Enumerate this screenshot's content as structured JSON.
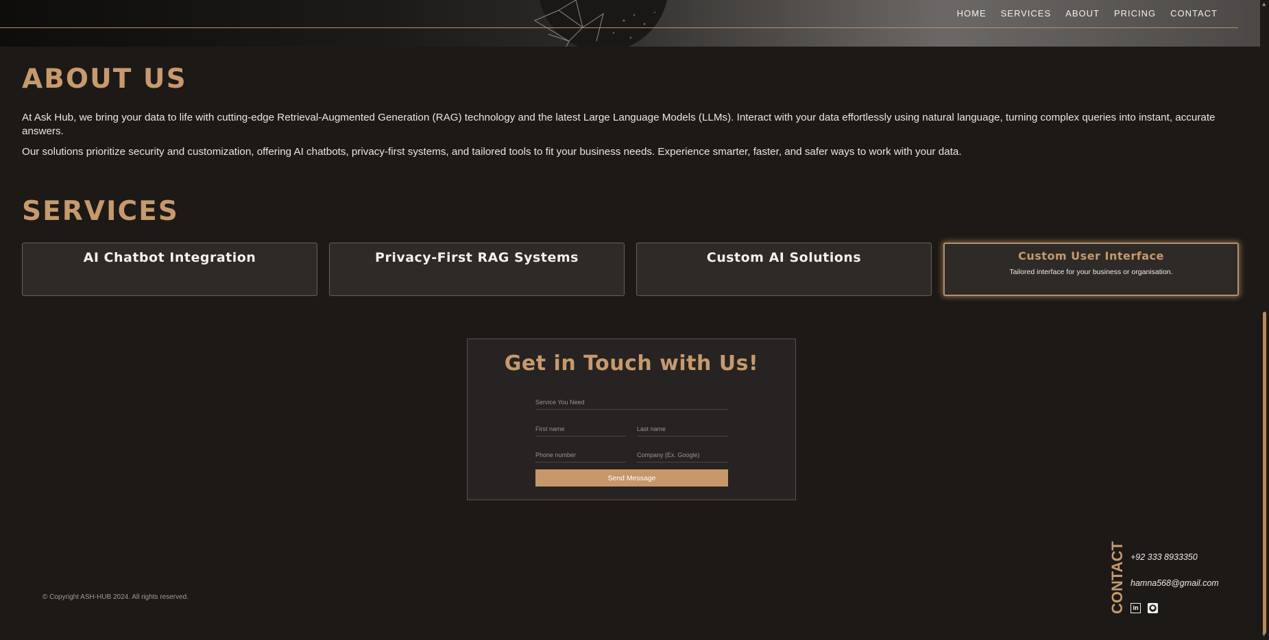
{
  "nav": {
    "items": [
      "HOME",
      "SERVICES",
      "ABOUT",
      "PRICING",
      "CONTACT"
    ]
  },
  "about": {
    "title": "ABOUT US",
    "p1": "At Ask Hub, we bring your data to life with cutting-edge Retrieval-Augmented Generation (RAG) technology and the latest Large Language Models (LLMs). Interact with your data effortlessly using natural language, turning complex queries into instant, accurate answers.",
    "p2": "Our solutions prioritize security and customization, offering AI chatbots, privacy-first systems, and tailored tools to fit your business needs. Experience smarter, faster, and safer ways to work with your data."
  },
  "services": {
    "title": "SERVICES",
    "cards": [
      {
        "title": "AI Chatbot Integration",
        "desc": ""
      },
      {
        "title": "Privacy-First RAG Systems",
        "desc": ""
      },
      {
        "title": "Custom AI Solutions",
        "desc": ""
      },
      {
        "title": "Custom User Interface",
        "desc": "Tailored interface for your business or organisation."
      }
    ]
  },
  "contact_form": {
    "title": "Get in Touch with Us!",
    "service_placeholder": "Service You Need",
    "first_name_placeholder": "First name",
    "last_name_placeholder": "Last name",
    "phone_placeholder": "Phone number",
    "company_placeholder": "Company (Ex. Google)",
    "submit_label": "Send Message"
  },
  "footer": {
    "copyright": "© Copyright ASH-HUB 2024. All rights reserved.",
    "contact_heading": "CONTACT",
    "phone": "+92 333 8933350",
    "email": "hamna568@gmail.com",
    "social_icons": [
      "linkedin-icon",
      "github-icon"
    ]
  },
  "colors": {
    "background": "#1d1916",
    "accent": "#c69a6e",
    "card": "#2e2a28",
    "button": "#c59769"
  }
}
